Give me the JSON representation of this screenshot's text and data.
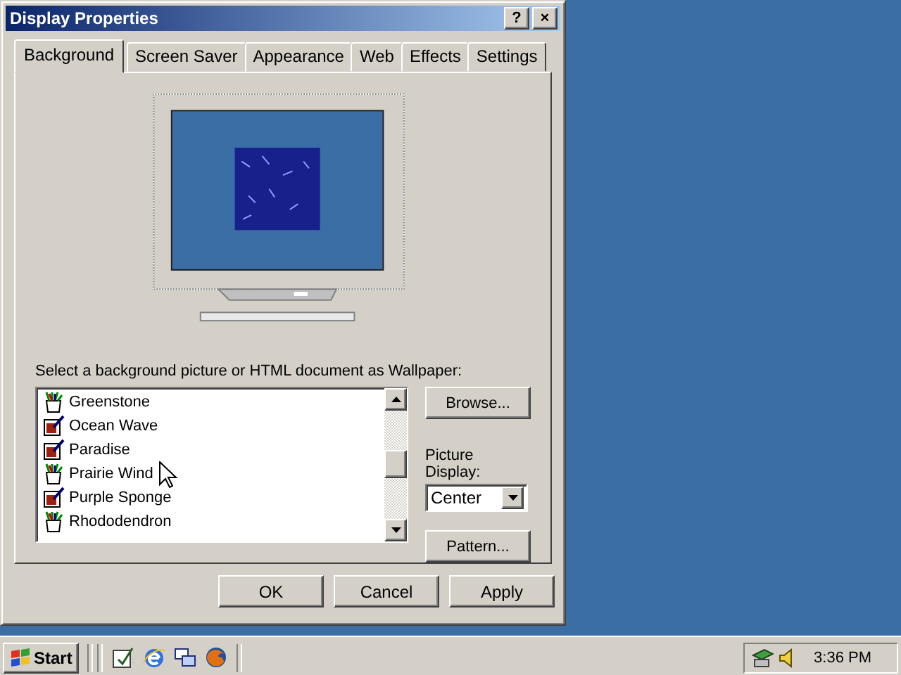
{
  "window": {
    "title": "Display Properties",
    "help_button": "?",
    "close_button": "×"
  },
  "tabs": [
    {
      "label": "Background",
      "selected": true
    },
    {
      "label": "Screen Saver",
      "selected": false
    },
    {
      "label": "Appearance",
      "selected": false
    },
    {
      "label": "Web",
      "selected": false
    },
    {
      "label": "Effects",
      "selected": false
    },
    {
      "label": "Settings",
      "selected": false
    }
  ],
  "wallpaper_label": "Select a background picture or HTML document as Wallpaper:",
  "wallpaper_list": [
    {
      "name": "Greenstone",
      "kind": "paint",
      "selected": false
    },
    {
      "name": "Ocean Wave",
      "kind": "document",
      "selected": false
    },
    {
      "name": "Paradise",
      "kind": "document",
      "selected": false
    },
    {
      "name": "Prairie Wind",
      "kind": "paint",
      "selected": false
    },
    {
      "name": "Purple Sponge",
      "kind": "document",
      "selected": false
    },
    {
      "name": "Rhododendron",
      "kind": "paint",
      "selected": false
    }
  ],
  "browse_button": "Browse...",
  "picture_display": {
    "label": "Picture Display:",
    "value": "Center"
  },
  "pattern_button": "Pattern...",
  "buttons": [
    "OK",
    "Cancel",
    "Apply"
  ],
  "taskbar": {
    "start": "Start",
    "clock": "3:36 PM"
  }
}
